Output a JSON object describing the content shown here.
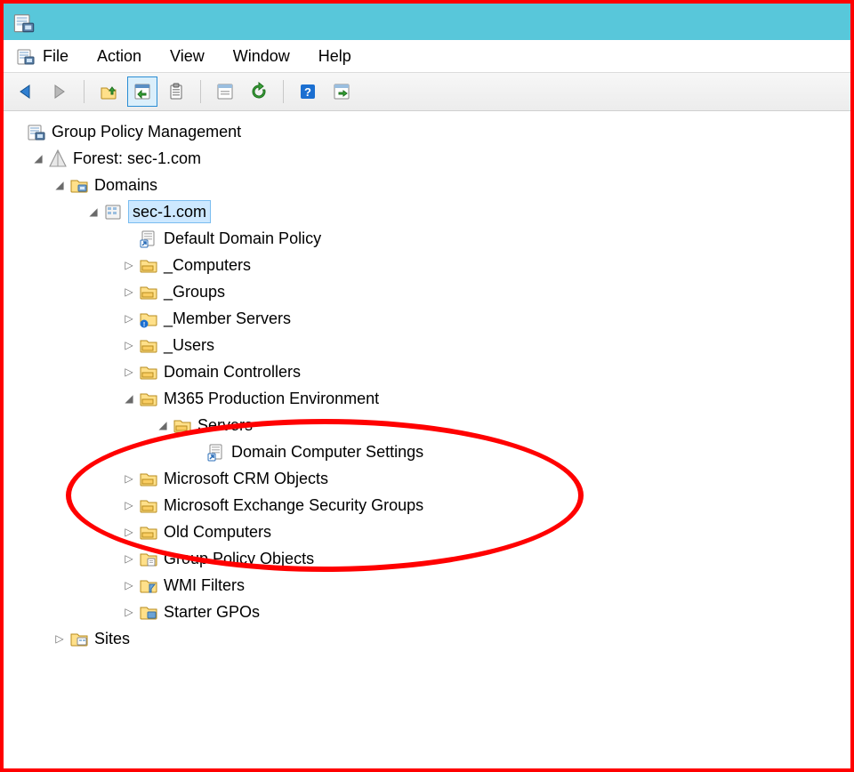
{
  "menus": {
    "file": "File",
    "action": "Action",
    "view": "View",
    "window": "Window",
    "help": "Help"
  },
  "tree": {
    "root": "Group Policy Management",
    "forest": "Forest: sec-1.com",
    "domains": "Domains",
    "domain": "sec-1.com",
    "default_policy": "Default Domain Policy",
    "computers": "_Computers",
    "groups": "_Groups",
    "member_servers": "_Member Servers",
    "users": "_Users",
    "domain_controllers": "Domain Controllers",
    "m365_prod": "M365 Production Environment",
    "servers": "Servers",
    "domain_comp_settings": "Domain Computer Settings",
    "ms_crm": "Microsoft CRM Objects",
    "ms_exch_sec": "Microsoft Exchange Security Groups",
    "old_computers": "Old Computers",
    "gpo": "Group Policy Objects",
    "wmi": "WMI Filters",
    "starter_gpos": "Starter GPOs",
    "sites": "Sites"
  }
}
